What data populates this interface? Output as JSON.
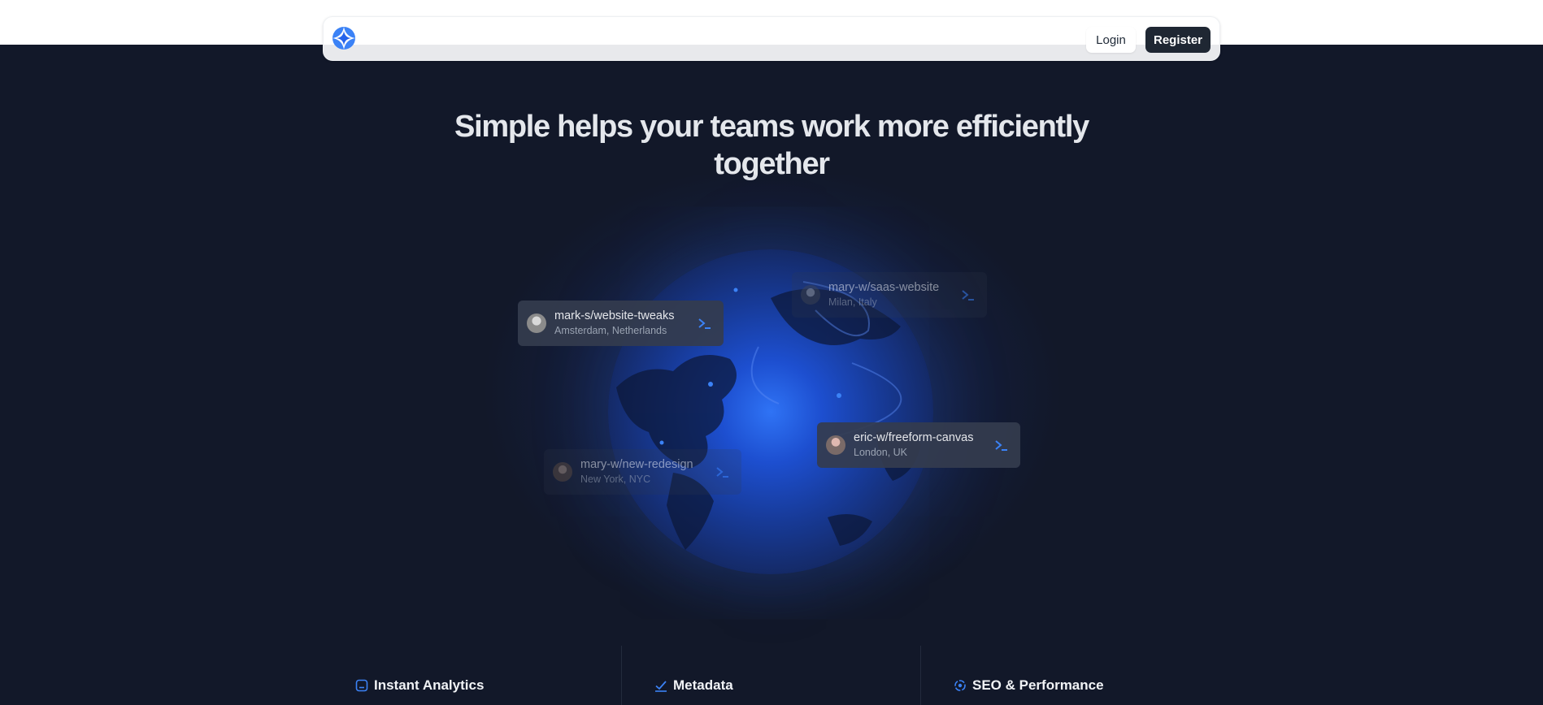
{
  "brand": {
    "logo_icon": "compass-logo-icon",
    "accent": "#3b82f6"
  },
  "nav": {
    "login_label": "Login",
    "register_label": "Register"
  },
  "hero": {
    "title": "Simple helps your teams work more efficiently together"
  },
  "cards": [
    {
      "title": "mark-s/website-tweaks",
      "location": "Amsterdam, Netherlands",
      "icon": "terminal-icon"
    },
    {
      "title": "mary-w/saas-website",
      "location": "Milan, Italy",
      "icon": "terminal-icon"
    },
    {
      "title": "eric-w/freeform-canvas",
      "location": "London, UK",
      "icon": "terminal-icon"
    },
    {
      "title": "mary-w/new-redesign",
      "location": "New York, NYC",
      "icon": "terminal-icon"
    }
  ],
  "features": [
    {
      "label": "Instant Analytics",
      "icon": "analytics-icon"
    },
    {
      "label": "Metadata",
      "icon": "check-icon"
    },
    {
      "label": "SEO & Performance",
      "icon": "target-icon"
    }
  ],
  "colors": {
    "background": "#121829",
    "card": "#343c4e",
    "register_bg": "#1f2733"
  }
}
